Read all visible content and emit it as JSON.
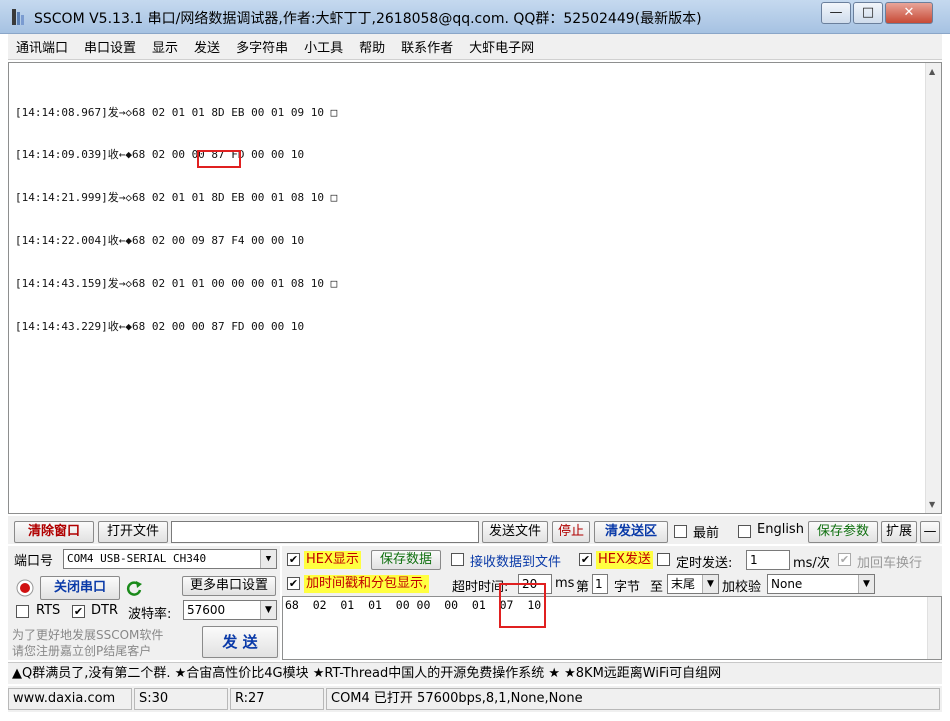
{
  "window": {
    "title": "SSCOM V5.13.1 串口/网络数据调试器,作者:大虾丁丁,2618058@qq.com. QQ群：52502449(最新版本)",
    "minimize": "—",
    "maximize": "□",
    "close": "✕"
  },
  "menu": [
    "通讯端口",
    "串口设置",
    "显示",
    "发送",
    "多字符串",
    "小工具",
    "帮助",
    "联系作者",
    "大虾电子网"
  ],
  "receive": {
    "lines": [
      "[14:14:08.967]发→◇68 02 01 01 8D EB 00 01 09 10 □",
      "[14:14:09.039]收←◆68 02 00 00 87 FD 00 00 10",
      "[14:14:21.999]发→◇68 02 01 01 8D EB 00 01 08 10 □",
      "[14:14:22.004]收←◆68 02 00 09 87 F4 00 00 10",
      "[14:14:43.159]发→◇68 02 01 01 00 00 00 01 08 10 □",
      "[14:14:43.229]收←◆68 02 00 00 87 FD 00 00 10"
    ]
  },
  "toolbar": {
    "clear_window": "清除窗口",
    "open_file": "打开文件",
    "file_path": "",
    "send_file": "发送文件",
    "stop": "停止",
    "clear_send": "清发送区",
    "topmost_label": "最前",
    "english_label": "English",
    "save_params": "保存参数",
    "expand": "扩展",
    "collapse": "—"
  },
  "port": {
    "port_label": "端口号",
    "port_value": "COM4 USB-SERIAL CH340",
    "close_port": "关闭串口",
    "more_settings": "更多串口设置",
    "rts_label": "RTS",
    "dtr_label": "DTR",
    "baud_label": "波特率:",
    "baud_value": "57600",
    "promo": [
      "为了更好地发展SSCOM软件",
      "请您注册嘉立创P结尾客户"
    ],
    "send_button": "发 送"
  },
  "options": {
    "hex_display": "HEX显示",
    "save_data": "保存数据",
    "recv_to_file": "接收数据到文件",
    "hex_send": "HEX发送",
    "timed_send": "定时发送:",
    "timed_value": "1",
    "ms_per": "ms/次",
    "add_crlf": "加回车换行",
    "timestamp": "加时间戳和分包显示,",
    "timeout_label": "超时时间:",
    "timeout_value": "20",
    "ms": "ms",
    "nth_label": "第",
    "nth_value": "1",
    "byte_label": "字节",
    "to_label": "至",
    "to_value": "末尾",
    "checksum_label": "加校验",
    "checksum_value": "None"
  },
  "send": {
    "text": "68  02  01  01  00 00  00  01  07  10"
  },
  "ticker": "▲Q群满员了,没有第二个群. ★合宙高性价比4G模块 ★RT-Thread中国人的开源免费操作系统 ★ ★8KM远距离WiFi可自组网",
  "status": {
    "site": "www.daxia.com",
    "sent": "S:30",
    "received": "R:27",
    "port_state": "COM4 已打开  57600bps,8,1,None,None"
  }
}
